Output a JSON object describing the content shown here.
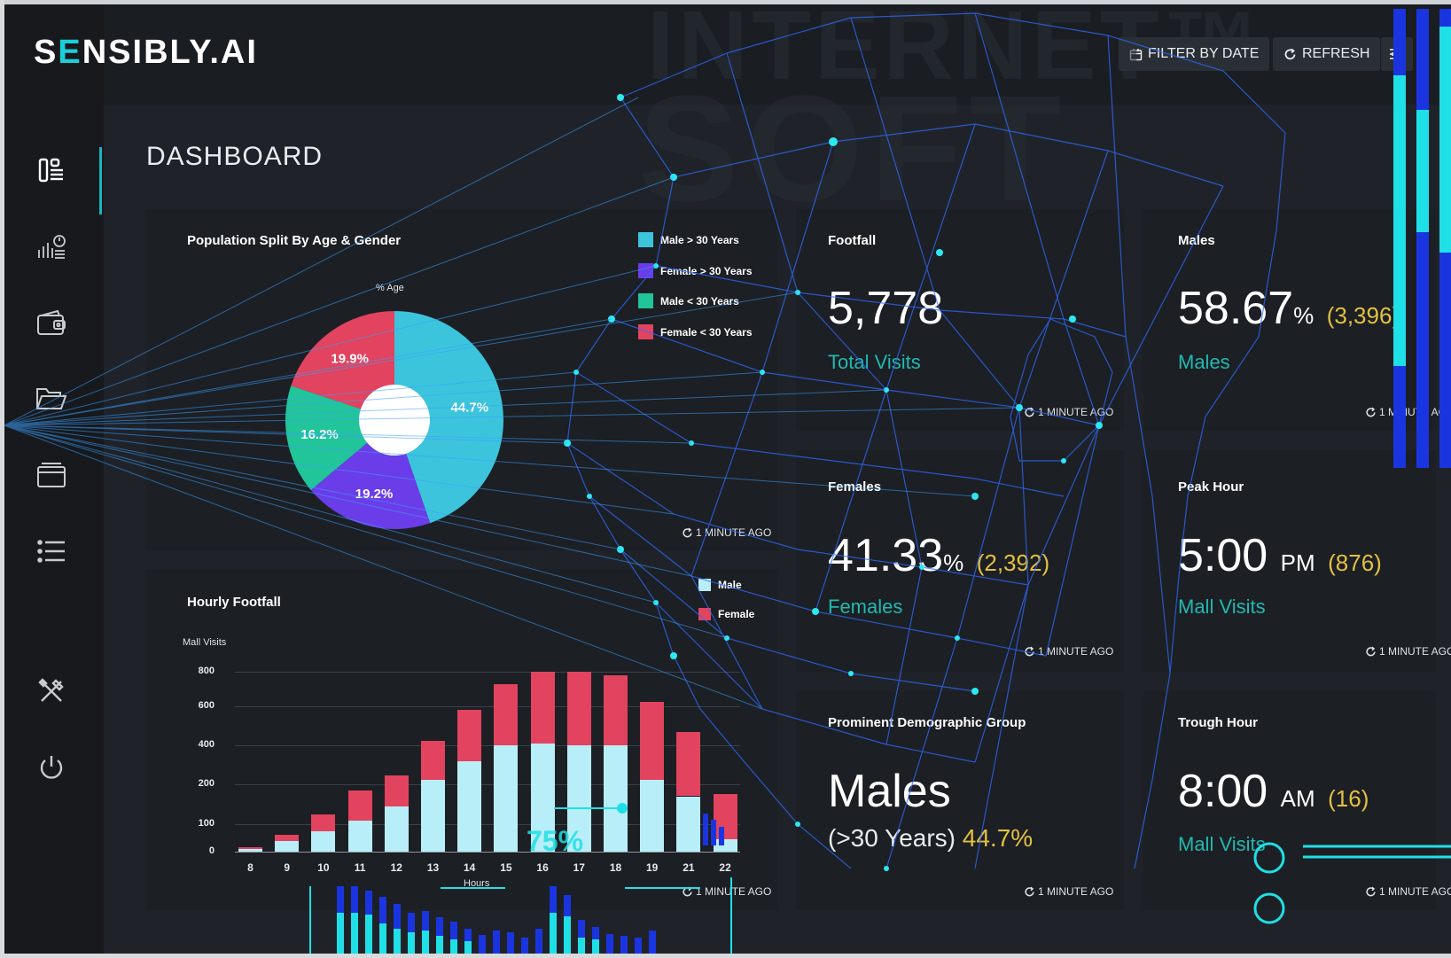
{
  "app": {
    "logo_parts": [
      "S",
      "E",
      "NSIBLY.AI"
    ],
    "page_title": "DASHBOARD",
    "watermark_1": "INTERNET™",
    "watermark_2": "SOFT"
  },
  "toolbar": {
    "filter_label": "FILTER BY DATE",
    "refresh_label": "REFRESH"
  },
  "sidebar": {
    "items": [
      {
        "icon": "dashboard-icon"
      },
      {
        "icon": "analytics-icon"
      },
      {
        "icon": "wallet-icon"
      },
      {
        "icon": "folder-icon"
      },
      {
        "icon": "card-icon"
      },
      {
        "icon": "list-icon"
      },
      {
        "icon": "tools-icon"
      },
      {
        "icon": "power-icon"
      }
    ]
  },
  "population": {
    "title": "Population Split By Age & Gender",
    "pie_caption": "% Age",
    "updated": "1 MINUTE AGO",
    "legend": [
      "Male > 30 Years",
      "Female > 30 Years",
      "Male < 30 Years",
      "Female < 30 Years"
    ],
    "colors": [
      "#3cc4dc",
      "#6a3de8",
      "#22c49a",
      "#e2435e"
    ]
  },
  "footfall": {
    "title": "Footfall",
    "value": "5,778",
    "sub": "Total Visits",
    "updated": "1 MINUTE AGO"
  },
  "males": {
    "title": "Males",
    "value": "58.67",
    "unit": "%",
    "count": "(3,396)",
    "sub": "Males",
    "updated": "1 MINUTE AGO"
  },
  "females": {
    "title": "Females",
    "value": "41.33",
    "unit": "%",
    "count": "(2,392)",
    "sub": "Females",
    "updated": "1 MINUTE AGO"
  },
  "peak": {
    "title": "Peak Hour",
    "value": "5:00",
    "unit": "PM",
    "count": "(876)",
    "sub": "Mall Visits",
    "updated": "1 MINUTE AGO"
  },
  "prominent": {
    "title": "Prominent Demographic Group",
    "value": "Males",
    "detail": "(>30 Years)",
    "percent": "44.7%",
    "updated": "1 MINUTE AGO"
  },
  "trough": {
    "title": "Trough Hour",
    "value": "8:00",
    "unit": "AM",
    "count": "(16)",
    "sub": "Mall Visits",
    "updated": "1 MINUTE AGO"
  },
  "hourly": {
    "title": "Hourly Footfall",
    "ylabel": "Mall Visits",
    "xlabel": "Hours",
    "legend": [
      "Male",
      "Female"
    ],
    "colors": [
      "#b8eef8",
      "#e2435e"
    ],
    "updated": "1 MINUTE AGO"
  },
  "overlay_text": {
    "percent_mark": "75%"
  },
  "chart_data": [
    {
      "type": "pie",
      "title": "Population Split By Age & Gender",
      "caption": "% Age",
      "categories": [
        "Male > 30 Years",
        "Female > 30 Years",
        "Male < 30 Years",
        "Female < 30 Years"
      ],
      "values": [
        44.7,
        19.2,
        16.2,
        19.9
      ],
      "colors": [
        "#3cc4dc",
        "#6a3de8",
        "#22c49a",
        "#e2435e"
      ]
    },
    {
      "type": "bar",
      "stacked": true,
      "title": "Hourly Footfall",
      "xlabel": "Hours",
      "ylabel": "Mall Visits",
      "categories": [
        "8",
        "9",
        "10",
        "11",
        "12",
        "13",
        "14",
        "15",
        "16",
        "17",
        "18",
        "19",
        "21",
        "22"
      ],
      "yticks": [
        0,
        100,
        200,
        400,
        600,
        800
      ],
      "series": [
        {
          "name": "Male",
          "values": [
            10,
            40,
            75,
            110,
            145,
            225,
            320,
            400,
            410,
            400,
            400,
            225,
            170,
            45
          ]
        },
        {
          "name": "Female",
          "values": [
            6,
            20,
            50,
            75,
            100,
            200,
            260,
            330,
            420,
            480,
            380,
            400,
            300,
            130
          ]
        }
      ],
      "colors": [
        "#b8eef8",
        "#e2435e"
      ],
      "grid": true,
      "legend": "inside-top-right"
    }
  ]
}
